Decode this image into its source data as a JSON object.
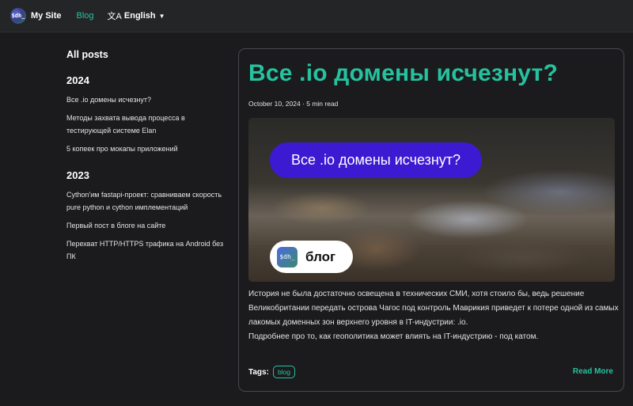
{
  "navbar": {
    "site_title": "My Site",
    "logo_text": "$dh_",
    "blog_link": "Blog",
    "language": "English",
    "language_icon": "translate-icon"
  },
  "sidebar": {
    "heading": "All posts",
    "groups": [
      {
        "year": "2024",
        "items": [
          "Все .io домены исчезнут?",
          "Методы захвата вывода процесса в тестирующей системе Elan",
          "5 копеек про мокапы приложений"
        ]
      },
      {
        "year": "2023",
        "items": [
          "Cython'им fastapi-проект: сравниваем скорость pure python и cython имплементаций",
          "Первый пост в блоге на сайте",
          "Перехват HTTP/HTTPS трафика на Android без ПК"
        ]
      }
    ]
  },
  "post": {
    "title": "Все .io домены исчезнут?",
    "meta": "October 10, 2024 · 5 min read",
    "hero": {
      "bubble_text": "Все .io домены исчезнут?",
      "pill_logo": "$dh_",
      "pill_text": "блог"
    },
    "body_lines": [
      "История не была достаточно освещена в технических СМИ, хотя стоило бы, ведь решение Великобритании передать острова Чагос под контроль Маврикия приведет к потере одной из самых лакомых доменных зон верхнего уровня в IT-индустрии: .io.",
      "Подробнее про то, как геополитика может влиять на IT-индустрию - под катом."
    ],
    "tags_label": "Tags:",
    "tags": [
      "blog"
    ],
    "read_more": "Read More"
  },
  "colors": {
    "accent": "#25c2a0",
    "background": "#1b1b1d",
    "navbar": "#242526",
    "bubble": "#3b1ad1"
  }
}
